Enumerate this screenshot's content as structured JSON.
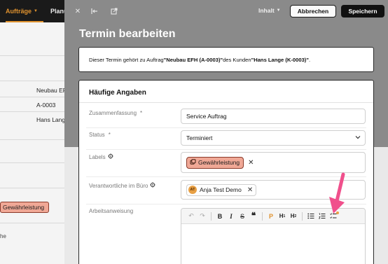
{
  "background": {
    "nav_active": "Aufträge",
    "nav_other": "Planu",
    "rows": [
      "Neubau EF",
      "A-0003",
      "Hans Lange"
    ],
    "chip_label": "Gewährleistung",
    "side_text": "he"
  },
  "modal": {
    "inhalt_label": "Inhalt",
    "cancel_label": "Abbrechen",
    "save_label": "Speichern",
    "title": "Termin bearbeiten",
    "notice": {
      "prefix": "Dieser Termin gehört zu Auftrag ",
      "order": "\"Neubau EFH (A-0003)\"",
      "middle": " des Kunden ",
      "customer": "\"Hans Lange (K-0003)\"",
      "suffix": "."
    },
    "section_title": "Häufige Angaben",
    "fields": {
      "summary_label": "Zusammenfassung",
      "summary_value": "Service Auftrag",
      "status_label": "Status",
      "status_value": "Terminiert",
      "labels_label": "Labels",
      "label_chip": "Gewährleistung",
      "office_label": "Verantwortliche im Büro",
      "user_initials": "AT",
      "user_name": "Anja Test Demo",
      "instructions_label": "Arbeitsanweisung",
      "required_mark": "*"
    }
  },
  "colors": {
    "accent": "#e0922e",
    "chip_bg": "#f0a896",
    "chip_border": "#8a3a2a",
    "annotation_arrow": "#f0508c"
  }
}
